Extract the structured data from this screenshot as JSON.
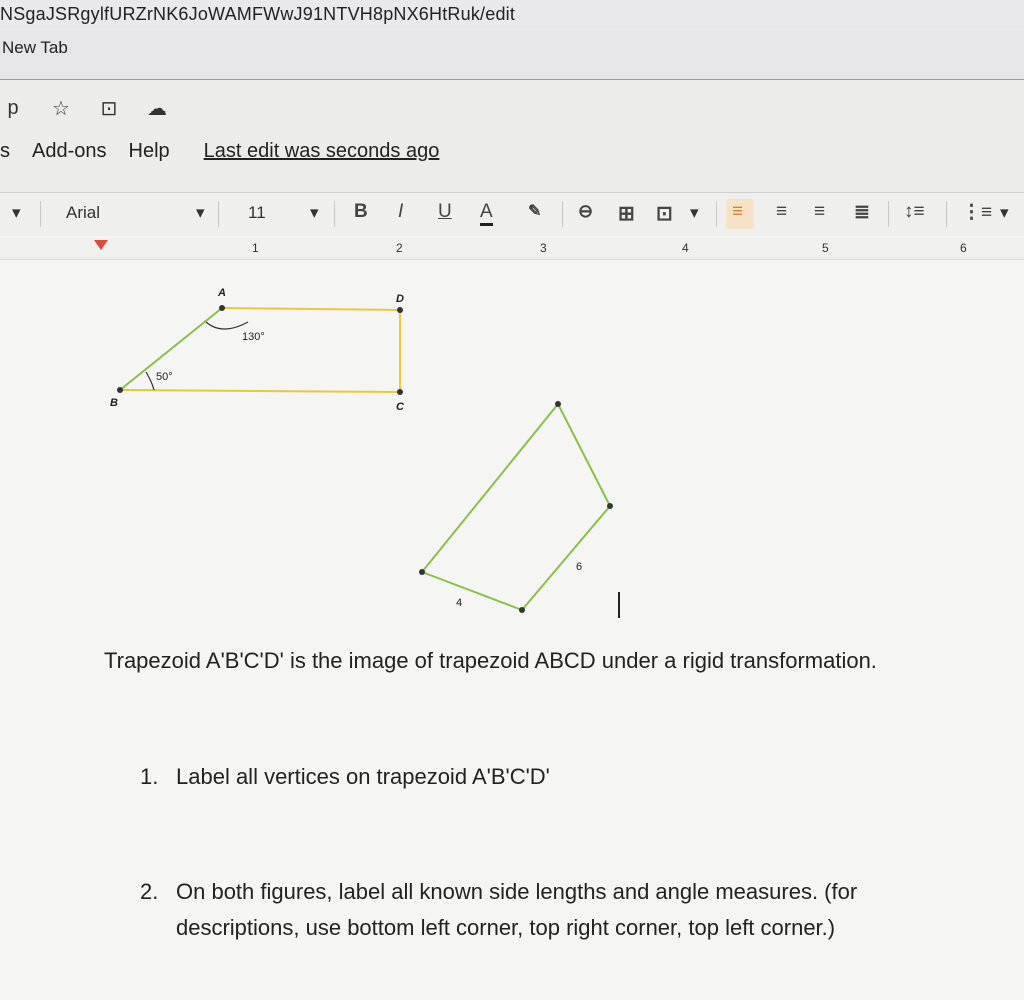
{
  "browser": {
    "url": "NSgaJSRgylfURZrNK6JoWAMFWwJ91NTVH8pNX6HtRuk/edit",
    "tab_title": "New Tab"
  },
  "docs": {
    "title_icons": [
      "text-p-icon",
      "star-icon",
      "move-to-folder-icon",
      "cloud-status-icon"
    ],
    "title_p": "p",
    "menu": {
      "item_partial": "s",
      "addons": "Add-ons",
      "help": "Help",
      "last_edit": "Last edit was seconds ago"
    },
    "toolbar": {
      "font": "Arial",
      "font_size": "11",
      "bold": "B",
      "italic": "I",
      "underline": "U",
      "text_color": "A",
      "accent_color": "#f3a34a"
    },
    "ruler": {
      "numbers": [
        "1",
        "2",
        "3",
        "4",
        "5",
        "6"
      ]
    }
  },
  "figures": {
    "abcd": {
      "labels": {
        "A": "A",
        "B": "B",
        "C": "C",
        "D": "D"
      },
      "angle_A": "130°",
      "angle_B": "50°"
    },
    "image": {
      "side_a": "6",
      "side_b": "4"
    },
    "colors": {
      "abcd_edges": "#e8c93a",
      "ab_edge": "#8bbf4a",
      "image_edges": "#8bbf4a"
    }
  },
  "content": {
    "main_text": "Trapezoid A'B'C'D' is the image of trapezoid ABCD  under a rigid transformation.",
    "q1_num": "1.",
    "q1_text": "Label all vertices on trapezoid A'B'C'D'",
    "q2_num": "2.",
    "q2_line1": "On both figures, label all known side lengths and angle measures. (for",
    "q2_line2": "descriptions, use bottom left corner, top right corner, top left corner.)"
  }
}
